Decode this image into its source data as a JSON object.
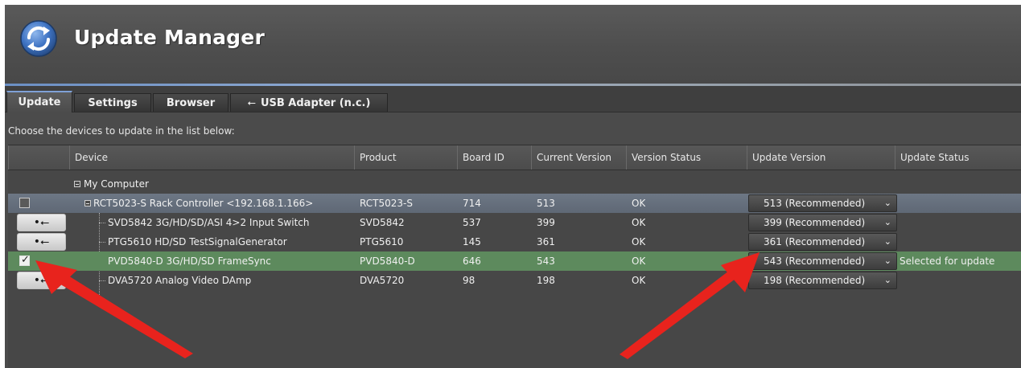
{
  "app": {
    "title": "Update Manager",
    "logo_icon": "refresh-circle-icon"
  },
  "tabs": [
    {
      "label": "Update",
      "active": true
    },
    {
      "label": "Settings",
      "active": false
    },
    {
      "label": "Browser",
      "active": false
    },
    {
      "label": "USB Adapter (n.c.)",
      "active": false,
      "icon": "usb-icon"
    }
  ],
  "instructions": "Choose the devices to update in the list below:",
  "table": {
    "columns": [
      "Device",
      "Product",
      "Board ID",
      "Current Version",
      "Version Status",
      "Update Version",
      "Update Status"
    ],
    "root": {
      "label": "My Computer"
    },
    "rows": [
      {
        "control": "checkbox",
        "checked": false,
        "device": "RCT5023-S Rack Controller <192.168.1.166>",
        "product": "RCT5023-S",
        "board_id": "714",
        "current_version": "513",
        "version_status": "OK",
        "update_version": "513 (Recommended)",
        "update_status": "",
        "highlight": "blue"
      },
      {
        "control": "usb",
        "device": "SVD5842 3G/HD/SD/ASI 4>2 Input Switch",
        "product": "SVD5842",
        "board_id": "537",
        "current_version": "399",
        "version_status": "OK",
        "update_version": "399 (Recommended)",
        "update_status": ""
      },
      {
        "control": "usb",
        "device": "PTG5610 HD/SD TestSignalGenerator",
        "product": "PTG5610",
        "board_id": "145",
        "current_version": "361",
        "version_status": "OK",
        "update_version": "361 (Recommended)",
        "update_status": ""
      },
      {
        "control": "checkbox",
        "checked": true,
        "device": "PVD5840-D 3G/HD/SD FrameSync",
        "product": "PVD5840-D",
        "board_id": "646",
        "current_version": "543",
        "version_status": "OK",
        "update_version": "543 (Recommended)",
        "update_status": "Selected for update",
        "highlight": "green"
      },
      {
        "control": "usb",
        "device": "DVA5720 Analog Video DAmp",
        "product": "DVA5720",
        "board_id": "98",
        "current_version": "198",
        "version_status": "OK",
        "update_version": "198 (Recommended)",
        "update_status": ""
      }
    ]
  },
  "colors": {
    "selected_row": "#5d8a5d",
    "controller_row": "#6d7785",
    "annotation_arrow": "#e8231d"
  }
}
